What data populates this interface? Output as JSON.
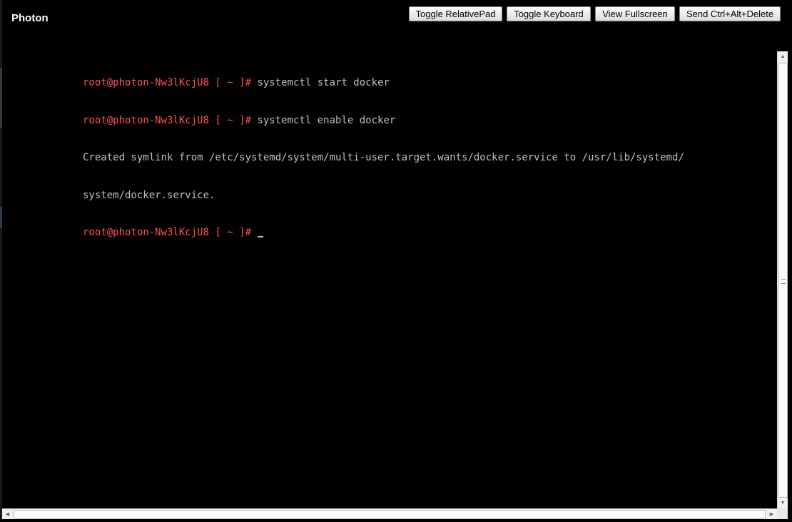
{
  "app": {
    "title": "Photon"
  },
  "toolbar": {
    "toggle_relativepad": "Toggle RelativePad",
    "toggle_keyboard": "Toggle Keyboard",
    "view_fullscreen": "View Fullscreen",
    "send_ctrl_alt_delete": "Send Ctrl+Alt+Delete"
  },
  "terminal": {
    "lines": [
      {
        "prompt": "root@photon-Nw3lKcjU8 [ ~ ]#",
        "text": " systemctl start docker"
      },
      {
        "prompt": "root@photon-Nw3lKcjU8 [ ~ ]#",
        "text": " systemctl enable docker"
      },
      {
        "prompt": "",
        "text": "Created symlink from /etc/systemd/system/multi-user.target.wants/docker.service to /usr/lib/systemd/"
      },
      {
        "prompt": "",
        "text": "system/docker.service."
      },
      {
        "prompt": "root@photon-Nw3lKcjU8 [ ~ ]#",
        "text": " "
      }
    ]
  },
  "colors": {
    "prompt": "#ff5050",
    "text": "#c0c0c0",
    "background": "#000000"
  },
  "icons": {
    "scroll_up": "triangle-up-icon",
    "scroll_down": "triangle-down-icon",
    "scroll_left": "triangle-left-icon",
    "scroll_right": "triangle-right-icon"
  }
}
